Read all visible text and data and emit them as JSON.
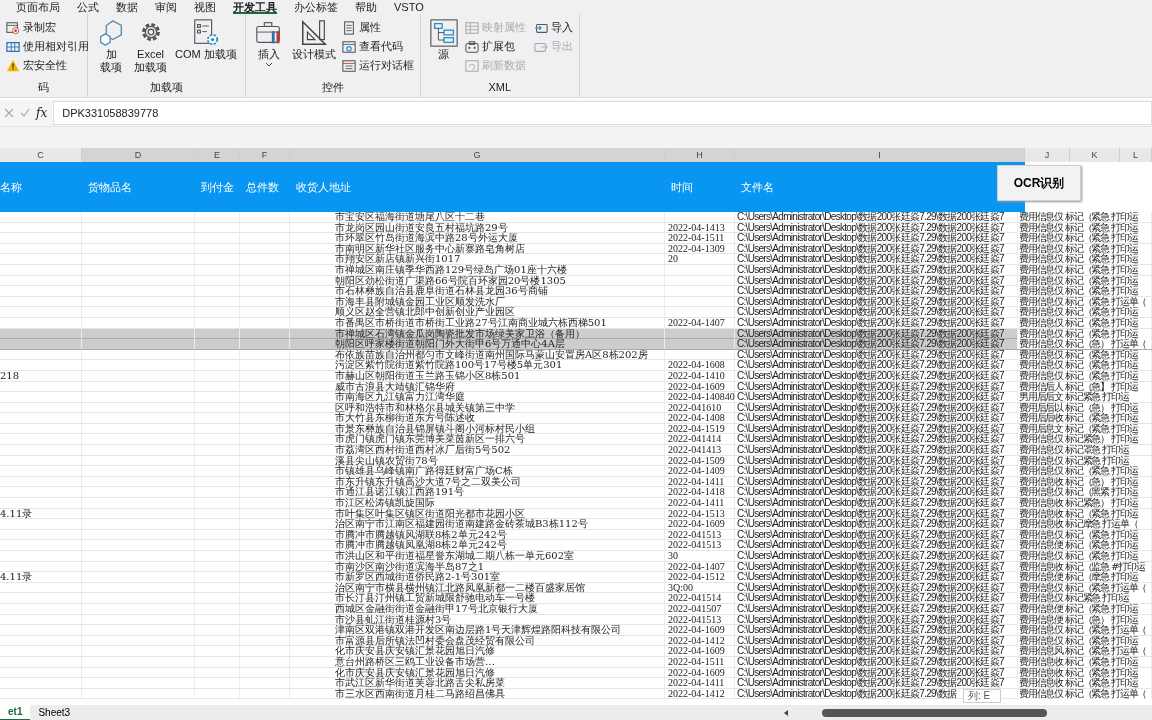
{
  "ribbon": {
    "tabs": [
      {
        "label": "页面布局",
        "selected": false
      },
      {
        "label": "公式",
        "selected": false
      },
      {
        "label": "数据",
        "selected": false
      },
      {
        "label": "审阅",
        "selected": false
      },
      {
        "label": "视图",
        "selected": false
      },
      {
        "label": "开发工具",
        "selected": true
      },
      {
        "label": "办公标签",
        "selected": false
      },
      {
        "label": "帮助",
        "selected": false
      },
      {
        "label": "VSTO",
        "selected": false
      }
    ],
    "groups": [
      {
        "label": "码",
        "items": [
          {
            "kind": "small",
            "lines": [
              "录制宏"
            ],
            "disabled": false
          },
          {
            "kind": "small",
            "lines": [
              "使用相对引用"
            ],
            "disabled": false
          },
          {
            "kind": "small",
            "lines": [
              "宏安全性"
            ],
            "disabled": false
          }
        ]
      },
      {
        "label": "加载项",
        "items": [
          {
            "kind": "large",
            "lines": [
              "加",
              "载项"
            ],
            "disabled": false
          },
          {
            "kind": "large",
            "lines": [
              "Excel",
              "加载项"
            ],
            "disabled": false
          },
          {
            "kind": "large",
            "lines": [
              "COM 加载项"
            ],
            "disabled": false
          }
        ]
      },
      {
        "label": "控件",
        "items": [
          {
            "kind": "large",
            "lines": [
              "插入"
            ],
            "dropdown": true,
            "disabled": false
          },
          {
            "kind": "large",
            "lines": [
              "设计模式"
            ],
            "disabled": false
          },
          {
            "kind": "small",
            "lines": [
              "属性"
            ],
            "disabled": false
          },
          {
            "kind": "small",
            "lines": [
              "查看代码"
            ],
            "disabled": false
          },
          {
            "kind": "small",
            "lines": [
              "运行对话框"
            ],
            "disabled": false
          }
        ]
      },
      {
        "label": "XML",
        "items": [
          {
            "kind": "large",
            "lines": [
              "源"
            ],
            "disabled": false
          },
          {
            "kind": "small",
            "lines": [
              "映射属性"
            ],
            "disabled": true
          },
          {
            "kind": "small",
            "lines": [
              "扩展包"
            ],
            "disabled": false
          },
          {
            "kind": "small",
            "lines": [
              "刷新数据"
            ],
            "disabled": true
          },
          {
            "kind": "small",
            "lines": [
              "导入"
            ],
            "disabled": false
          },
          {
            "kind": "small",
            "lines": [
              "导出"
            ],
            "disabled": true
          }
        ]
      }
    ]
  },
  "formula_bar": {
    "function_label": "fx",
    "value": "DPK331058839778"
  },
  "column_letters": [
    "C",
    "D",
    "E",
    "F",
    "G",
    "H",
    "I",
    "J",
    "K",
    "L"
  ],
  "headers": [
    "名称",
    "货物品名",
    "到付金",
    "总件数",
    "收货人地址",
    "时间",
    "文件名"
  ],
  "ocr_button": "OCR识别",
  "rows": [
    {
      "selected": false,
      "address": "市宝安区福海街道塘尾八区十二巷",
      "path": "C:\\Users\\Administrator\\Desktop\\数据200张廷焱7.29\\数据200张廷焱7",
      "extra": "费用信息仅 标记（紧急 打印运"
    },
    {
      "selected": false,
      "address": "市龙岗区园山街道安良五村福坑路29号",
      "time": "2022-04-1413",
      "path": "C:\\Users\\Administrator\\Desktop\\数据200张廷焱7.29\\数据200张廷焱7",
      "extra": "费用信息仅 标记（紧急 打印运"
    },
    {
      "selected": false,
      "address": "市环翠区竹岛街道海滨中路28号外运大厦",
      "time": "2022-04-1511",
      "path": "C:\\Users\\Administrator\\Desktop\\数据200张廷焱7.29\\数据200张廷焱7",
      "extra": "费用信息仅 标记（紧急 打印运"
    },
    {
      "selected": false,
      "address": "市南明区新华社区服务中心新寨路皂角树店",
      "time": "2022-04-1309",
      "path": "C:\\Users\\Administrator\\Desktop\\数据200张廷焱7.29\\数据200张廷焱7",
      "extra": "费用信息仅 标记（紧急 打印运"
    },
    {
      "selected": false,
      "address": "市翔安区新店镇新兴街1017",
      "time": "20",
      "path": "C:\\Users\\Administrator\\Desktop\\数据200张廷焱7.29\\数据200张廷焱7",
      "extra": "费用信息仅 标记（紧急 打印运"
    },
    {
      "selected": false,
      "address": "市禅城区南庄镇季华西路129号绿岛广场01座十六楼",
      "path": "C:\\Users\\Administrator\\Desktop\\数据200张廷焱7.29\\数据200张廷焱7",
      "extra": "费用信息仅 标记（紧急 打印运"
    },
    {
      "selected": false,
      "address": "朝阳区劲松街道广渠路66号院百环家园20号楼1305",
      "path": "C:\\Users\\Administrator\\Desktop\\数据200张廷焱7.29\\数据200张廷焱7",
      "extra": "费用信息仅 标记（紧急 打印运"
    },
    {
      "selected": false,
      "address": "市石林彝族自治县鹿阜街道石林县龙园36号商铺",
      "path": "C:\\Users\\Administrator\\Desktop\\数据200张廷焱7.29\\数据200张廷焱7",
      "extra": "费用信息仅 标记（紧急 打印运"
    },
    {
      "selected": false,
      "address": "市海丰县附城镇金园工业区顺发洗水厂",
      "path": "C:\\Users\\Administrator\\Desktop\\数据200张廷焱7.29\\数据200张廷焱7",
      "extra": "费用信息仅 标记（紧急 打运单（"
    },
    {
      "selected": false,
      "address": "顺义区赵全营镇北郎中创新创业产业园区",
      "path": "C:\\Users\\Administrator\\Desktop\\数据200张廷焱7.29\\数据200张廷焱7",
      "extra": "费用信息仅 标记（紧急 打印运"
    },
    {
      "selected": false,
      "address": "市番禺区市桥街道市桥街工业路27号江南商业城六栋西梯501",
      "time": "2022-04-1407",
      "path": "C:\\Users\\Administrator\\Desktop\\数据200张廷焱7.29\\数据200张廷焱7",
      "extra": "费用信息仅 标记（紧急 打印运"
    },
    {
      "selected": true,
      "address": "市禅城区石湾镇金瓜岗陶瓷批发市场绿美家卫浴（备用）",
      "path": "C:\\Users\\Administrator\\Desktop\\数据200张廷焱7.29\\数据200张廷焱7",
      "extra": "费用信息仅 标记（紧急 打印运"
    },
    {
      "selected": true,
      "address": "朝阳区呼家楼街道朝阳门外大街甲6号万通中心4A层",
      "path": "C:\\Users\\Administrator\\Desktop\\数据200张廷焱7.29\\数据200张廷焱7",
      "extra": "费用信息仅 标记（急） 打运单（"
    },
    {
      "selected": false,
      "address": "布依族苗族自治州都匀市文峰街道南州国际马蒙山安置房A区8栋202房",
      "path": "C:\\Users\\Administrator\\Desktop\\数据200张廷焱7.29\\数据200张廷焱7",
      "extra": "费用信息仅 标记（紧急 打印运"
    },
    {
      "selected": false,
      "address": "污淀区紫竹院街道紫竹院路100号17号楼5单元301",
      "time": "2022-04-1608",
      "path": "C:\\Users\\Administrator\\Desktop\\数据200张廷焱7.29\\数据200张廷焱7",
      "extra": "费用信息仅 标记（紧急 打印运"
    },
    {
      "selected": false,
      "col_c": "218",
      "address": "市赫山区朝阳街道玉兰路玉锦小区8栋501",
      "time": "2022-04-1410",
      "path": "C:\\Users\\Administrator\\Desktop\\数据200张廷焱7.29\\数据200张廷焱7",
      "extra": "费用信息仅 标记（紧急 打印运"
    },
    {
      "selected": false,
      "address": "威市古浪县大靖镇汇锦华府",
      "time": "2022-04-1609",
      "path": "C:\\Users\\Administrator\\Desktop\\数据200张廷焱7.29\\数据200张廷焱7",
      "extra": "费用信后人 标记（急】 打印运"
    },
    {
      "selected": false,
      "address": "市南海区九江镇富力江湾华庭",
      "time": "2022-04-140840",
      "path": "C:\\Users\\Administrator\\Desktop\\数据200张廷焱7.29\\数据200张廷焱7",
      "extra": "男用后后文 标记紧急 打印运"
    },
    {
      "selected": false,
      "address": "区呼和浩特市和林格尔县城关镇第三中学",
      "time": "2022-041610",
      "path": "C:\\Users\\Administrator\\Desktop\\数据200张廷焱7.29\\数据200张廷焱7",
      "extra": "费用后后以 标记（急） 打印运"
    },
    {
      "selected": false,
      "address": "市大竹县东柳街道东方号陈述收",
      "time": "2022-04-1408",
      "path": "C:\\Users\\Administrator\\Desktop\\数据200张廷焱7.29\\数据200张廷焱7",
      "extra": "费用后后收 标记（紧急 打印运"
    },
    {
      "selected": false,
      "address": "市景东彝族自治县锦屏镇斗阁小河标村民小组",
      "time": "2022-04-1519",
      "path": "C:\\Users\\Administrator\\Desktop\\数据200张廷焱7.29\\数据200张廷焱7",
      "extra": "费用后息文 标记（紧急 打印运"
    },
    {
      "selected": false,
      "address": "市虎门镇虎门镇东莞博美菜茵新区一排六号",
      "time": "2022-041414",
      "path": "C:\\Users\\Administrator\\Desktop\\数据200张廷焱7.29\\数据200张廷焱7",
      "extra": "费用信息仅 标记紧急） 打印运"
    },
    {
      "selected": false,
      "address": "市荔湾区西村街道西村冰厂后街5号502",
      "time": "2022-041413",
      "path": "C:\\Users\\Administrator\\Desktop\\数据200张廷焱7.29\\数据200张廷焱7",
      "extra": "费用信息仅 标记罩急 打印运"
    },
    {
      "selected": false,
      "address": "溪县尖山镇农贸街78号",
      "time": "2022-04-1509",
      "path": "C:\\Users\\Administrator\\Desktop\\数据200张廷焱7.29\\数据200张廷焱7",
      "extra": "费用信息仅 标记紧急 打印运"
    },
    {
      "selected": false,
      "address": "市镇雄县乌峰镇南广路得廷财富广场C栋",
      "time": "2022-04-1409",
      "path": "C:\\Users\\Administrator\\Desktop\\数据200张廷焱7.29\\数据200张廷焱7",
      "extra": "费用信息仅 标记（紧急 打印运"
    },
    {
      "selected": false,
      "address": "市东升镇东升镇高沙大道7号之二双美公司",
      "time": "2022-04-1411",
      "path": "C:\\Users\\Administrator\\Desktop\\数据200张廷焱7.29\\数据200张廷焱7",
      "extra": "费用信息收 标记（急） 打印运"
    },
    {
      "selected": false,
      "address": "市通江县诺江镇江西路191号",
      "time": "2022-04-1418",
      "path": "C:\\Users\\Administrator\\Desktop\\数据200张廷焱7.29\\数据200张廷焱7",
      "extra": "费用信息仅 标记（黑紧 打印运"
    },
    {
      "selected": false,
      "address": "市江区松涛镇凯旋国际",
      "time": "2022-04-1411",
      "path": "C:\\Users\\Administrator\\Desktop\\数据200张廷焱7.29\\数据200张廷焱7",
      "extra": "费用信息收 标记紧急） 打印运"
    },
    {
      "selected": false,
      "col_c": "4.11录",
      "address": "市叶集区叶集区镇区街道阳光都市花园小区",
      "time": "2022-04-1513",
      "path": "C:\\Users\\Administrator\\Desktop\\数据200张廷焱7.29\\数据200张廷焱7",
      "extra": "费用信息收 标记（紧急 打印运"
    },
    {
      "selected": false,
      "address": "治区南宁市江南区福建园街道南建路金砖茶城B3栋112号",
      "time": "2022-04-1609",
      "path": "C:\\Users\\Administrator\\Desktop\\数据200张廷焱7.29\\数据200张廷焱7",
      "extra": "费用信息收 标记摩急 打运单（"
    },
    {
      "selected": false,
      "address": "市腾冲市腾越镇风湖联8栋2单元242号",
      "time": "2022-041513",
      "path": "C:\\Users\\Administrator\\Desktop\\数据200张廷焱7.29\\数据200张廷焱7",
      "extra": "费用信息仅 标记（紧急 打印运"
    },
    {
      "selected": false,
      "address": "市腾冲市腾越镇凤凰湖8栋2单元242号",
      "time": "2022-041513",
      "path": "C:\\Users\\Administrator\\Desktop\\数据200张廷焱7.29\\数据200张廷焱7",
      "extra": "费用信息便 标记（紧急 打印运"
    },
    {
      "selected": false,
      "address": "市洪山区和平街道福星誉东湖城二期八栋一单元602室",
      "time": "30",
      "path": "C:\\Users\\Administrator\\Desktop\\数据200张廷焱7.29\\数据200张廷焱7",
      "extra": "费用信息仅 标记（紧急 打印运"
    },
    {
      "selected": false,
      "address": "市南沙区南沙街道滨海半岛87之1",
      "time": "2022-04-1407",
      "path": "C:\\Users\\Administrator\\Desktop\\数据200张廷焱7.29\\数据200张廷焱7",
      "extra": "费用信息收 标记（监急 #打印运"
    },
    {
      "selected": false,
      "col_c": "4.11录",
      "address": "市新罗区西城街道侨民路2-1号301室",
      "time": "2022-04-1512",
      "path": "C:\\Users\\Administrator\\Desktop\\数据200张廷焱7.29\\数据200张廷焱7",
      "extra": "费用信息便 标记（摩急 打印运"
    },
    {
      "selected": false,
      "address": "治区南宁市横县横州镇江北路凤凰新都一二楼百盛家居馆",
      "time": "3Q:00",
      "path": "C:\\Users\\Administrator\\Desktop\\数据200张廷焱7.29\\数据200张廷焱7",
      "extra": "费用信息仅 标记（紧急 打运单（"
    },
    {
      "selected": false,
      "address": "市长汀县汀州镇工贸新城限舒驰电动车一号楼",
      "time": "2022-041514",
      "path": "C:\\Users\\Administrator\\Desktop\\数据200张廷焱7.29\\数据200张廷焱7",
      "extra": "费用信息仅 标记紧急 打印运"
    },
    {
      "selected": false,
      "address": "西城区金融街街道金融街甲17号北京银行大厦",
      "time": "2022-041507",
      "path": "C:\\Users\\Administrator\\Desktop\\数据200张廷焱7.29\\数据200张廷焱7",
      "extra": "费用信息便 标记（紧急 打印运"
    },
    {
      "selected": false,
      "address": "市沙县虬江街道桂源村3号",
      "time": "2022-041513",
      "path": "C:\\Users\\Administrator\\Desktop\\数据200张廷焱7.29\\数据200张廷焱7",
      "extra": "费用信息便 标记（急） 打印运"
    },
    {
      "selected": false,
      "address": "津南区双港镇双港开发区南边层路1号天津辉煌路阳科技有限公司",
      "time": "2022-04-1609",
      "path": "C:\\Users\\Administrator\\Desktop\\数据200张廷焱7.29\\数据200张廷焱7",
      "extra": "费用信息仅 标记（紧急 打运单（"
    },
    {
      "selected": false,
      "address": "市富源县后所镇法凹村委会盘茂经贸有限公司",
      "time": "2022-04-1412",
      "path": "C:\\Users\\Administrator\\Desktop\\数据200张廷焱7.29\\数据200张廷焱7",
      "extra": "费用信息仅 标记（紧急 打印运"
    },
    {
      "selected": false,
      "address": "化市庆安县庆安镇汇景花园旭日汽修",
      "time": "2022-04-1609",
      "path": "C:\\Users\\Administrator\\Desktop\\数据200张廷焱7.29\\数据200张廷焱7",
      "extra": "费用信息风 标记（紧急 打运单（"
    },
    {
      "selected": false,
      "address": "意台州路桥区三鸥工业设备市场营…",
      "time": "2022-04-1511",
      "path": "C:\\Users\\Administrator\\Desktop\\数据200张廷焱7.29\\数据200张廷焱7",
      "extra": "费用信息收 标记（紧急 打印运"
    },
    {
      "selected": false,
      "address": "化市庆安县庆安镇汇景花园旭日汽修",
      "time": "2022-04-1609",
      "path": "C:\\Users\\Administrator\\Desktop\\数据200张廷焱7.29\\数据200张廷焱7",
      "extra": "费用信息收 标记（紧急 打印运"
    },
    {
      "selected": false,
      "address": "市武江区新华街道芙蓉北路舌尖私房菜",
      "time": "2022-04-1411",
      "path": "C:\\Users\\Administrator\\Desktop\\数据200张廷焱7.29\\数据200张廷焱7",
      "extra": "费用信息收 标记（紧急 打印运"
    },
    {
      "selected": false,
      "address": "市三水区西南街道月桂二马路绍昌佛具",
      "time": "2022-04-1412",
      "path": "C:\\Users\\Administrator\\Desktop\\数据200张廷焱7.29\\数据",
      "extra": "费用信息仅 标记（紧急 打运单（"
    }
  ],
  "tooltip": "列: E",
  "sheet_tabs": [
    {
      "label": "et1",
      "selected": true
    },
    {
      "label": "Sheet3",
      "selected": false
    }
  ]
}
